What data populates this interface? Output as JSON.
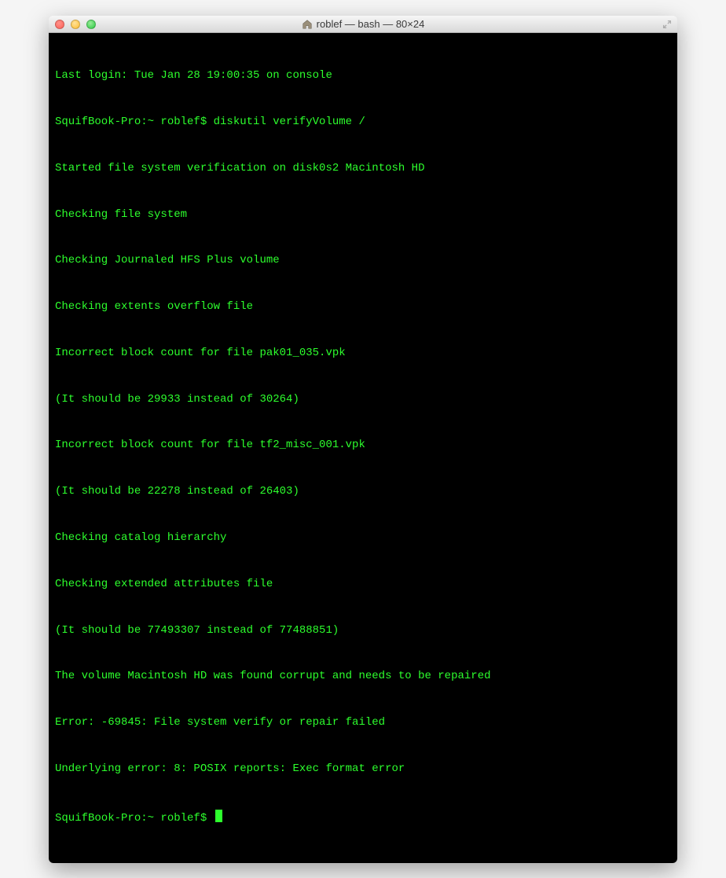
{
  "window": {
    "title": "roblef — bash — 80×24"
  },
  "terminal": {
    "lines": [
      "Last login: Tue Jan 28 19:00:35 on console",
      "SquifBook-Pro:~ roblef$ diskutil verifyVolume /",
      "Started file system verification on disk0s2 Macintosh HD",
      "Checking file system",
      "Checking Journaled HFS Plus volume",
      "Checking extents overflow file",
      "Incorrect block count for file pak01_035.vpk",
      "(It should be 29933 instead of 30264)",
      "Incorrect block count for file tf2_misc_001.vpk",
      "(It should be 22278 instead of 26403)",
      "Checking catalog hierarchy",
      "Checking extended attributes file",
      "(It should be 77493307 instead of 77488851)",
      "The volume Macintosh HD was found corrupt and needs to be repaired",
      "Error: -69845: File system verify or repair failed",
      "Underlying error: 8: POSIX reports: Exec format error"
    ],
    "prompt": "SquifBook-Pro:~ roblef$ "
  }
}
